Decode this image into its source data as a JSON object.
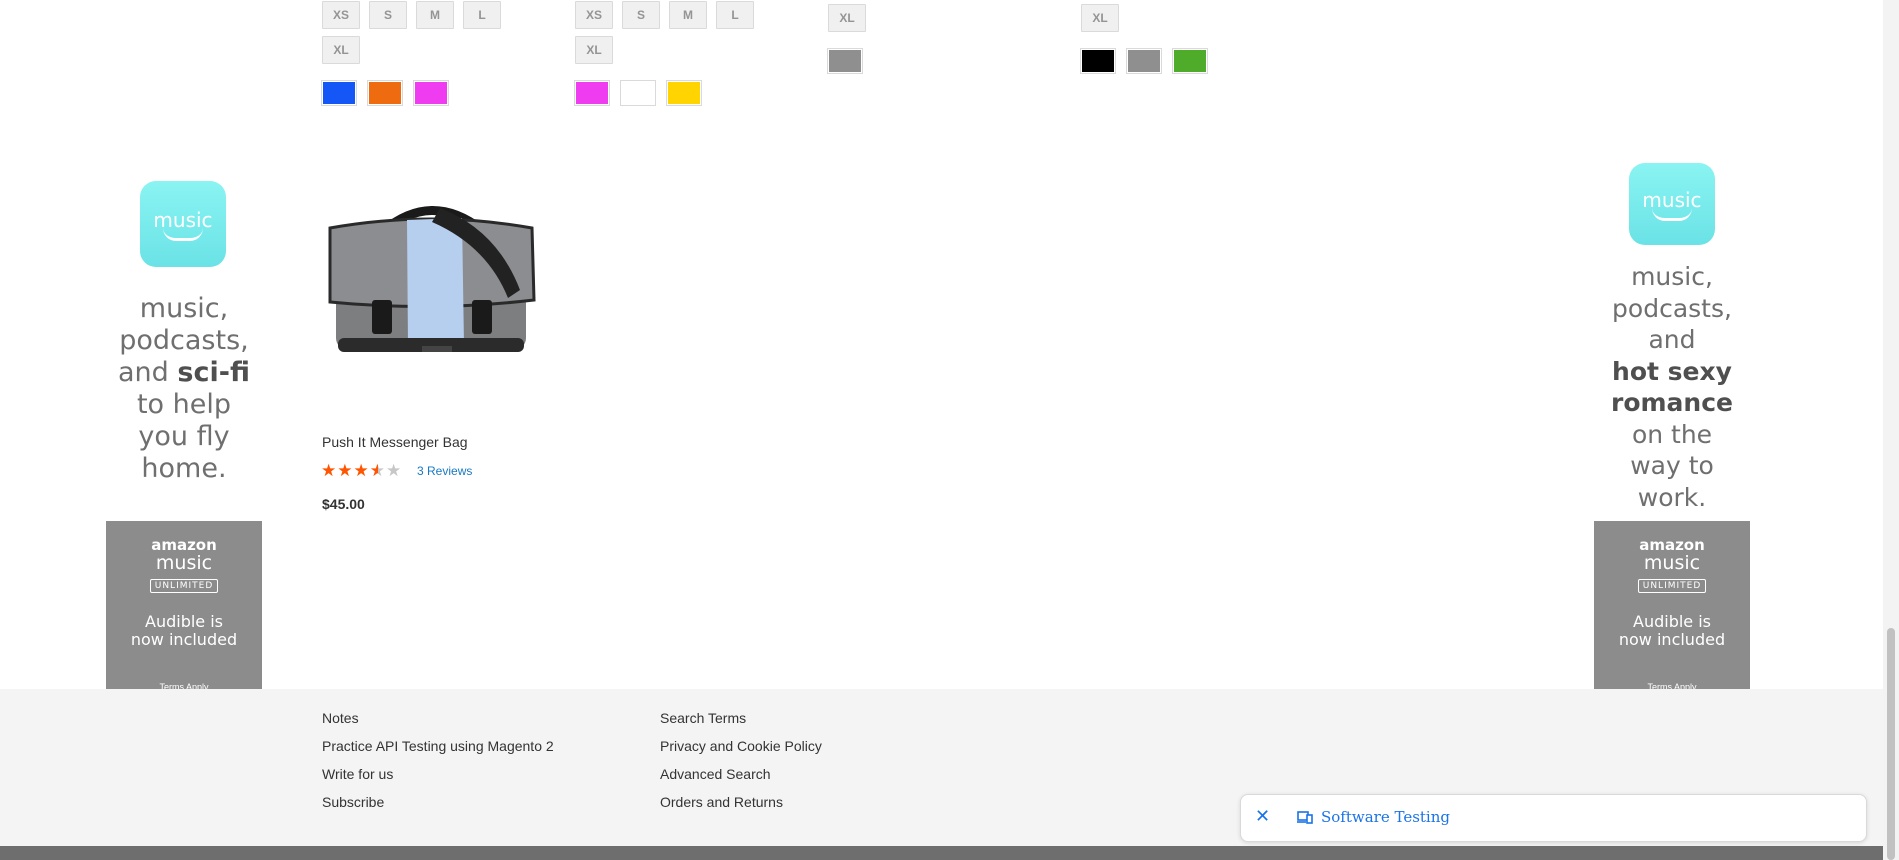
{
  "swatch_rows": {
    "product_1": {
      "sizes_row1": [
        "XS",
        "S",
        "M",
        "L"
      ],
      "sizes_row2": [
        "XL"
      ],
      "colors": [
        "#1556f7",
        "#ef6b0f",
        "#f03cf1"
      ]
    },
    "product_2": {
      "sizes_row1": [
        "XS",
        "S",
        "M",
        "L"
      ],
      "sizes_row2": [
        "XL"
      ],
      "colors": [
        "#f03cf1",
        "#ffffff",
        "#ffd400"
      ]
    },
    "product_3": {
      "sizes_row1": [
        "XL"
      ],
      "colors": [
        "#8f8f8f"
      ]
    },
    "product_4": {
      "sizes_row1": [
        "XL"
      ],
      "colors": [
        "#000000",
        "#8f8f8f",
        "#4fab2a"
      ]
    }
  },
  "ads": {
    "left": {
      "tile_label": "music",
      "copy_line1": "music,",
      "copy_line2": "podcasts,",
      "copy_line3_plain": "and ",
      "copy_line3_bold": "sci-fi",
      "copy_line4": "to help",
      "copy_line5": "you fly",
      "copy_line6": "home.",
      "brand_line1": "amazon",
      "brand_line2": "music",
      "brand_line3": "UNLIMITED",
      "audible_line1": "Audible is",
      "audible_line2": "now included",
      "terms": "Terms Apply"
    },
    "right": {
      "tile_label": "music",
      "copy_line1": "music,",
      "copy_line2": "podcasts,",
      "copy_line3": "and",
      "copy_line4_bold": "hot sexy",
      "copy_line5_bold": "romance",
      "copy_line6": "on the",
      "copy_line7": "way to",
      "copy_line8": "work.",
      "brand_line1": "amazon",
      "brand_line2": "music",
      "brand_line3": "UNLIMITED",
      "audible_line1": "Audible is",
      "audible_line2": "now included",
      "terms": "Terms Apply"
    }
  },
  "product": {
    "name": "Push It Messenger Bag",
    "rating_fraction": 0.5,
    "reviews_label": "3 Reviews",
    "price": "$45.00"
  },
  "footer": {
    "col1": [
      "Notes",
      "Practice API Testing using Magento 2",
      "Write for us",
      "Subscribe"
    ],
    "col2": [
      "Search Terms",
      "Privacy and Cookie Policy",
      "Advanced Search",
      "Orders and Returns"
    ]
  },
  "toast": {
    "label": "Software Testing"
  },
  "colors": {
    "star_on": "#ff5501",
    "link": "#1979c3",
    "toast_link": "#1a73e8"
  }
}
